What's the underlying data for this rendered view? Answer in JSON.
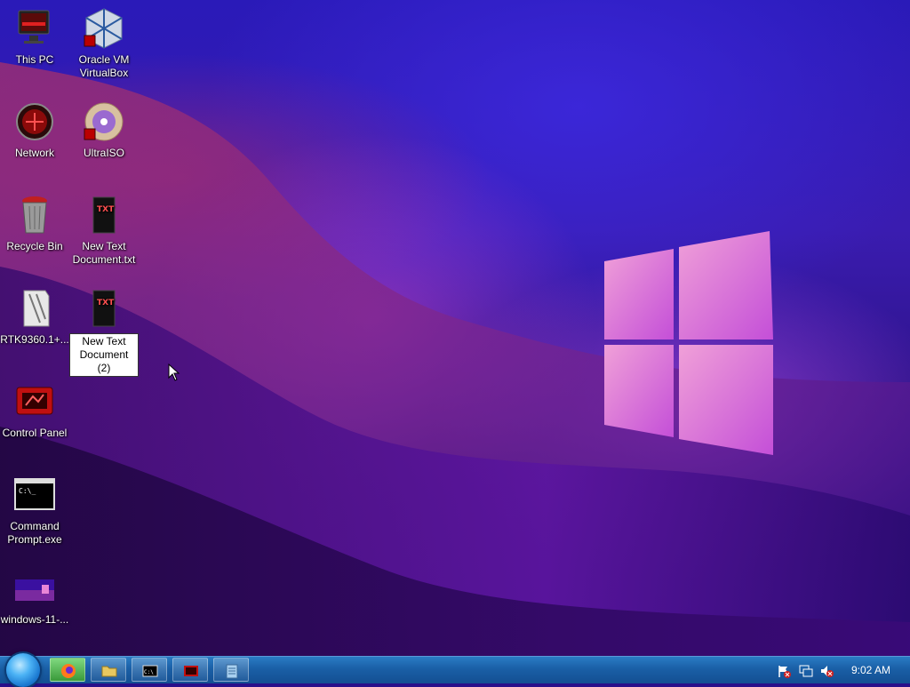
{
  "desktop": {
    "icons": [
      {
        "label": "This PC",
        "icon": "computer-icon"
      },
      {
        "label": "Oracle VM VirtualBox",
        "icon": "virtualbox-icon"
      },
      {
        "label": "Network",
        "icon": "network-icon"
      },
      {
        "label": "UltraISO",
        "icon": "ultraiso-icon"
      },
      {
        "label": "Recycle Bin",
        "icon": "recycle-bin-icon"
      },
      {
        "label": "New Text Document.txt",
        "icon": "text-file-icon"
      },
      {
        "label": "RTK9360.1+...",
        "icon": "archive-icon"
      },
      {
        "label": "New Text Document (2)",
        "icon": "text-file-icon"
      },
      {
        "label": "Control Panel",
        "icon": "control-panel-icon"
      },
      {
        "label": "Command Prompt.exe",
        "icon": "cmd-icon"
      },
      {
        "label": "windows-11-...",
        "icon": "image-file-icon"
      }
    ]
  },
  "taskbar": {
    "start_button": "start-orb",
    "pinned": [
      {
        "name": "firefox",
        "icon": "firefox-icon",
        "active": true
      },
      {
        "name": "file-explorer",
        "icon": "folder-icon",
        "active": false
      },
      {
        "name": "command-prompt",
        "icon": "cmd-icon",
        "active": false
      },
      {
        "name": "control-panel",
        "icon": "control-panel-icon",
        "active": false
      },
      {
        "name": "notepad",
        "icon": "notepad-icon",
        "active": false
      }
    ],
    "tray": {
      "icons": [
        "action-center-flag-icon",
        "network-status-icon",
        "volume-muted-icon"
      ],
      "clock": "9:02 AM"
    }
  },
  "colors": {
    "taskbar": "#1a5fa6",
    "active_button": "#4caf50",
    "logo_pink": "#e985d6"
  }
}
